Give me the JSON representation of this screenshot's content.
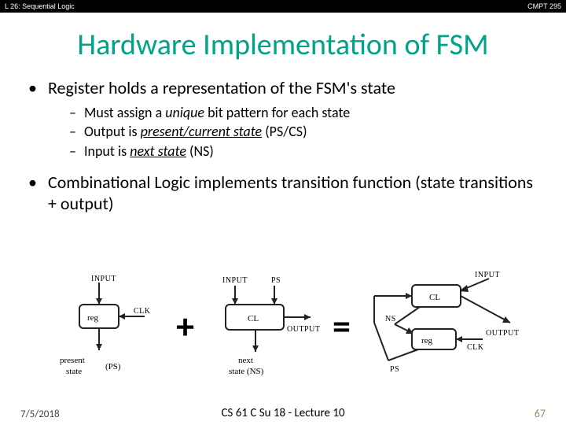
{
  "header": {
    "left": "L 26: Sequential Logic",
    "right": "CMPT 295"
  },
  "title": "Hardware Implementation of FSM",
  "bullets": {
    "b1": "Register holds a representation of the FSM's state",
    "s1a_pre": "Must assign a ",
    "s1a_em": "unique",
    "s1a_post": " bit pattern for each state",
    "s1b_pre": "Output is ",
    "s1b_em": "present/current state",
    "s1b_post": " (PS/CS)",
    "s1c_pre": "Input is ",
    "s1c_em": "next state",
    "s1c_post": " (NS)",
    "b2": "Combinational Logic implements transition function (state transitions + output)"
  },
  "diagram": {
    "input_top_a": "INPUT",
    "reg": "reg",
    "clk": "CLK",
    "present": "present",
    "state": "state",
    "ps_short": "(PS)",
    "plus": "+",
    "input_top_b": "INPUT",
    "ps_top": "PS",
    "cl": "CL",
    "output": "OUTPUT",
    "next_a": "next",
    "next_b": "state (NS)",
    "equals": "=",
    "ns_label": "NS"
  },
  "footer": {
    "date": "7/5/2018",
    "center": "CS 61 C Su 18 - Lecture 10",
    "page": "67"
  }
}
